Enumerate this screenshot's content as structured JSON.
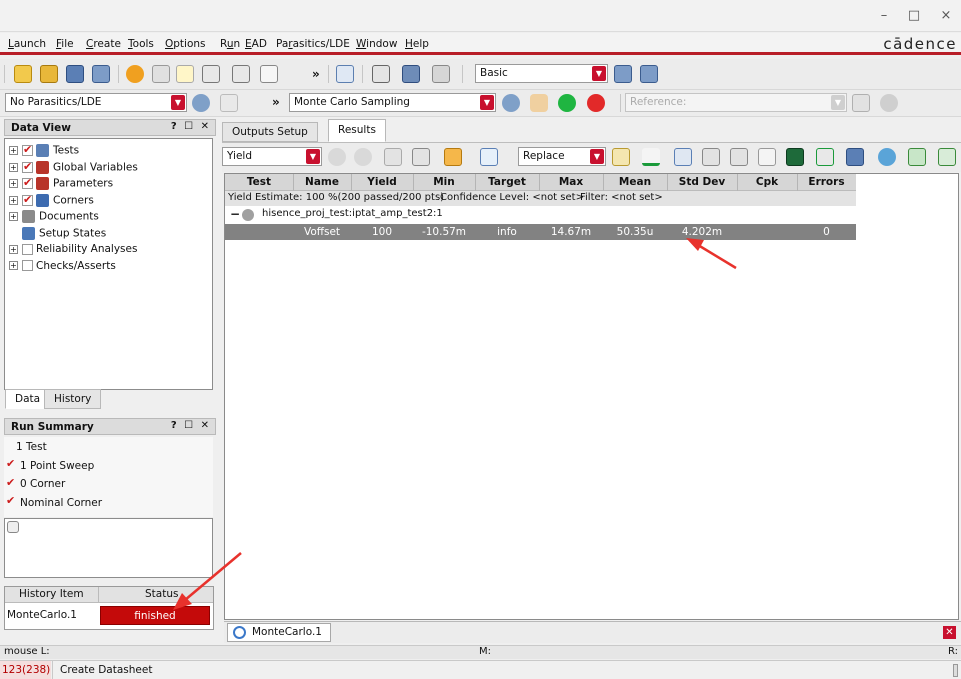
{
  "window": {
    "minimize": "–",
    "maximize": "□",
    "close": "×"
  },
  "menu": {
    "items": [
      {
        "pre": "",
        "u": "L",
        "post": "aunch"
      },
      {
        "pre": "",
        "u": "F",
        "post": "ile"
      },
      {
        "pre": "",
        "u": "C",
        "post": "reate"
      },
      {
        "pre": "",
        "u": "T",
        "post": "ools"
      },
      {
        "pre": "",
        "u": "O",
        "post": "ptions"
      },
      {
        "pre": "R",
        "u": "u",
        "post": "n"
      },
      {
        "pre": "",
        "u": "E",
        "post": "AD"
      },
      {
        "pre": "Pa",
        "u": "r",
        "post": "asitics/LDE"
      },
      {
        "pre": "",
        "u": "W",
        "post": "indow"
      },
      {
        "pre": "",
        "u": "H",
        "post": "elp"
      }
    ],
    "brand": "cādence"
  },
  "toolbar1": {
    "mode_combo": "Basic",
    "chevron": "»"
  },
  "toolbar2": {
    "parasitics_combo": "No Parasitics/LDE",
    "chevron": "»",
    "run_mode_combo": "Monte Carlo Sampling",
    "reference_label": "Reference:",
    "reference_value": ""
  },
  "data_view": {
    "title": "Data View",
    "controls": "? ☐ ✕",
    "tree": [
      {
        "label": "Tests",
        "expander": true,
        "checked": true,
        "icon_color": "#5a7fb5"
      },
      {
        "label": "Global Variables",
        "expander": true,
        "checked": true,
        "icon_color": "#b8342a"
      },
      {
        "label": "Parameters",
        "expander": true,
        "checked": true,
        "icon_color": "#b8342a"
      },
      {
        "label": "Corners",
        "expander": true,
        "checked": true,
        "icon_color": "#3d6bb0"
      },
      {
        "label": "Documents",
        "expander": true,
        "checked": null,
        "icon_color": "#8a8a8a"
      },
      {
        "label": "Setup States",
        "expander": false,
        "checked": null,
        "icon_color": "#4a78b8"
      },
      {
        "label": "Reliability Analyses",
        "expander": true,
        "checked": false,
        "icon_color": ""
      },
      {
        "label": "Checks/Asserts",
        "expander": true,
        "checked": false,
        "icon_color": ""
      }
    ],
    "tabs": [
      "Data",
      "History"
    ]
  },
  "run_summary": {
    "title": "Run Summary",
    "controls": "? ☐ ✕",
    "items": [
      {
        "label": "1 Test",
        "checked": null
      },
      {
        "label": "1 Point Sweep",
        "checked": true
      },
      {
        "label": "0 Corner",
        "checked": true
      },
      {
        "label": "Nominal Corner",
        "checked": true
      }
    ]
  },
  "history": {
    "headers": [
      "History Item",
      "Status"
    ],
    "rows": [
      {
        "item": "MonteCarlo.1",
        "status": "finished"
      }
    ]
  },
  "main_tabs": [
    "Outputs Setup",
    "Results"
  ],
  "results_toolbar": {
    "view_combo": "Yield",
    "replace_combo": "Replace"
  },
  "grid": {
    "headers": [
      "Test",
      "Name",
      "Yield",
      "Min",
      "Target",
      "Max",
      "Mean",
      "Std Dev",
      "Cpk",
      "Errors"
    ],
    "yield_estimate": "Yield Estimate: 100 %(200 passed/200 pts)",
    "confidence": "Confidence Level: <not set>",
    "filter": "Filter: <not set>",
    "test_name": "hisence_proj_test:iptat_amp_test2:1",
    "row": {
      "test": "",
      "name": "Voffset",
      "yield": "100",
      "min": "-10.57m",
      "target": "info",
      "max": "14.67m",
      "mean": "50.35u",
      "std_dev": "4.202m",
      "cpk": "",
      "errors": "0"
    }
  },
  "bottom_tab": "MonteCarlo.1",
  "status": {
    "mouse": "mouse L:",
    "mid": "M:",
    "right": "R:",
    "counter": "123(238)",
    "message": "Create Datasheet"
  },
  "colors": {
    "accent": "#c8102e",
    "row_bg": "#828282",
    "finished_bg": "#c40a0a",
    "arrow": "#e8322c"
  }
}
